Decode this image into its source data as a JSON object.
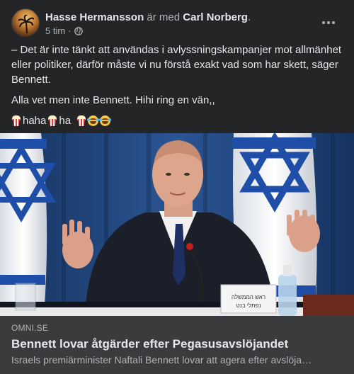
{
  "post": {
    "author": "Hasse Hermansson",
    "with_text": "är med",
    "tagged": "Carl Norberg",
    "period": ".",
    "time": "5 tim",
    "dot": "·",
    "privacy_icon": "globe-icon",
    "more_icon": "more-options-icon",
    "paragraph1": "– Det är inte tänkt att användas i avlyssningskampanjer mot allmänhet eller politiker, därför måste vi nu förstå exakt vad som har skett, säger Bennett.",
    "paragraph2": "Alla vet men inte Bennett. Hihi ring en vän,,",
    "emoji_text1": "haha",
    "emoji_text2": "ha"
  },
  "link": {
    "source": "OMNI.SE",
    "title": "Bennett lovar åtgärder efter Pegasusavslöjandet",
    "description": "Israels premiärminister Naftali Bennett lovar att agera efter avslöja…",
    "image_alt": "Naftali Bennett speaking at a podium in front of Israeli flags"
  },
  "colors": {
    "background": "#242526",
    "link_panel": "#3a3b3c",
    "text_primary": "#e4e6eb",
    "text_secondary": "#b0b3b8",
    "flag_blue": "#1f4ea8"
  }
}
